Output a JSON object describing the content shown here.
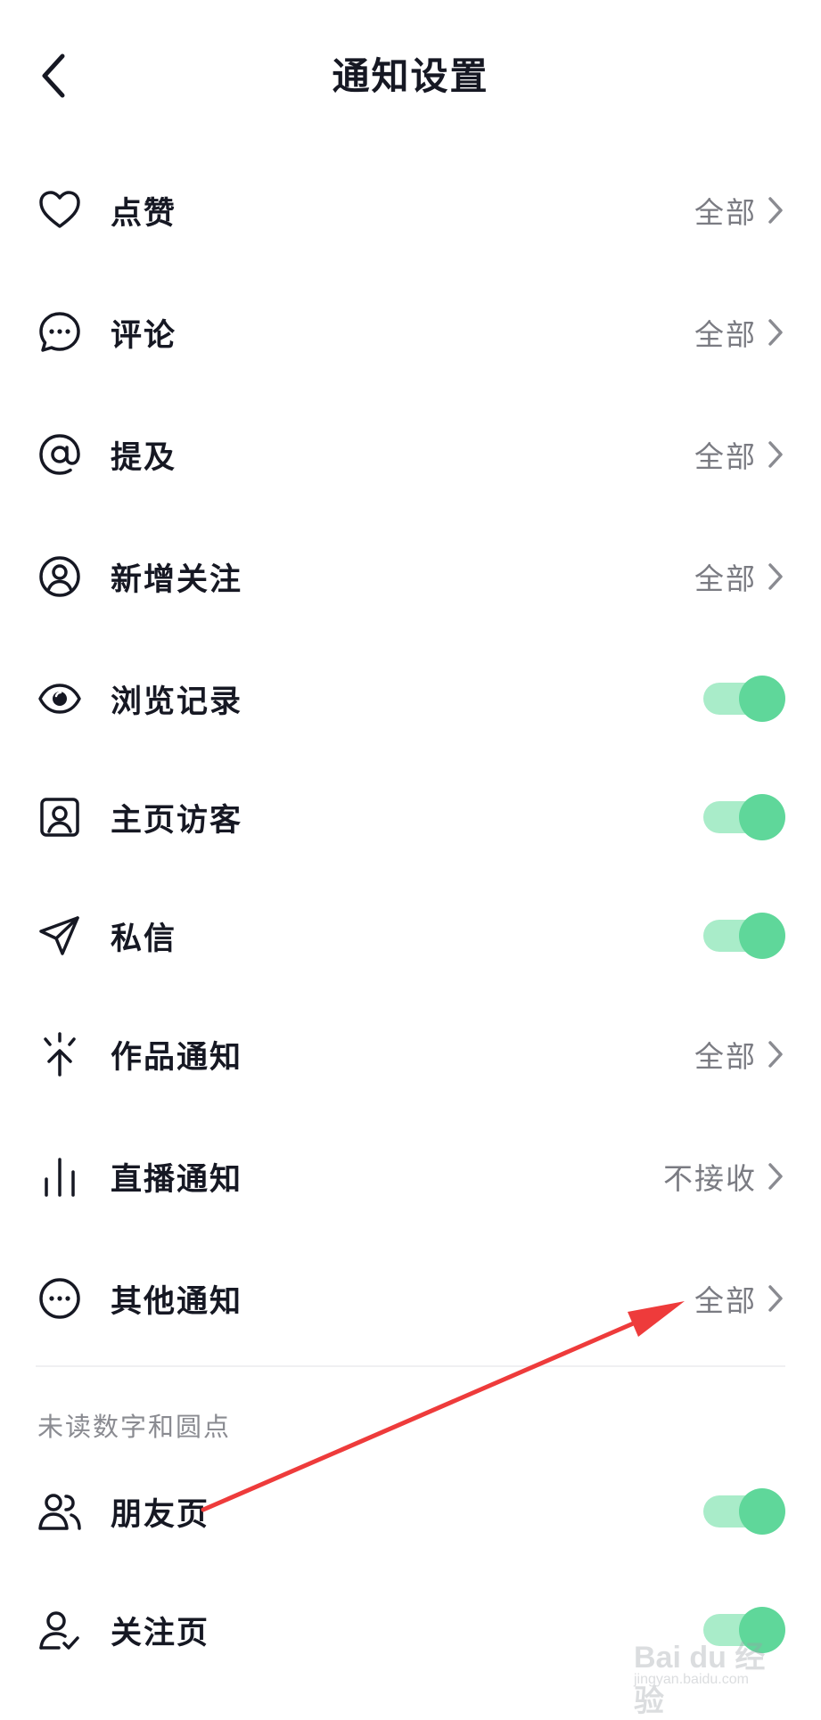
{
  "header": {
    "title": "通知设置",
    "back_icon": "chevron-left-icon"
  },
  "settings": [
    {
      "label": "点赞",
      "icon": "heart-icon",
      "type": "select",
      "value": "全部"
    },
    {
      "label": "评论",
      "icon": "comment-bubble-icon",
      "type": "select",
      "value": "全部"
    },
    {
      "label": "提及",
      "icon": "at-sign-icon",
      "type": "select",
      "value": "全部"
    },
    {
      "label": "新增关注",
      "icon": "user-circle-icon",
      "type": "select",
      "value": "全部"
    },
    {
      "label": "浏览记录",
      "icon": "eye-icon",
      "type": "toggle",
      "on": true
    },
    {
      "label": "主页访客",
      "icon": "profile-card-icon",
      "type": "toggle",
      "on": true
    },
    {
      "label": "私信",
      "icon": "send-icon",
      "type": "toggle",
      "on": true
    },
    {
      "label": "作品通知",
      "icon": "sparkle-arrow-icon",
      "type": "select",
      "value": "全部"
    },
    {
      "label": "直播通知",
      "icon": "bars-icon",
      "type": "select",
      "value": "不接收"
    },
    {
      "label": "其他通知",
      "icon": "more-circle-icon",
      "type": "select",
      "value": "全部"
    }
  ],
  "unread_section": {
    "title": "未读数字和圆点",
    "items": [
      {
        "label": "朋友页",
        "icon": "friends-icon",
        "type": "toggle",
        "on": true
      },
      {
        "label": "关注页",
        "icon": "user-check-icon",
        "type": "toggle",
        "on": true
      }
    ]
  },
  "colors": {
    "toggle_knob": "#5fd79a",
    "toggle_track": "#a9ecc9",
    "value_text": "#7a7b82",
    "annotation_arrow": "#ee3b3b"
  },
  "watermark": {
    "text": "Bai du 经验",
    "sub": "jingyan.baidu.com"
  }
}
